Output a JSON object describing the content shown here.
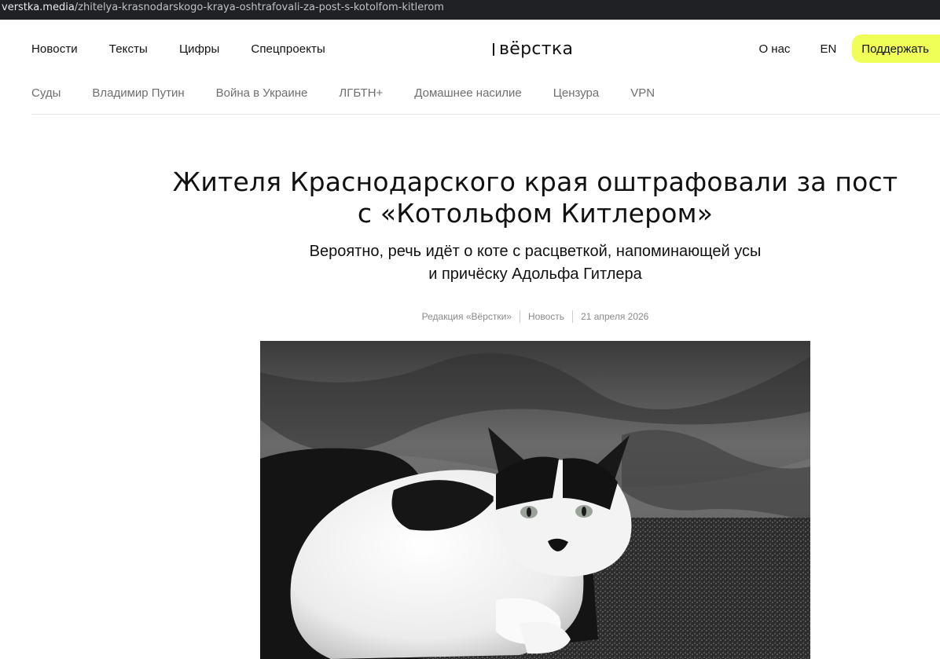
{
  "browser": {
    "url_host": "verstka.media",
    "url_path": "/zhitelya-krasnodarskogo-kraya-oshtrafovali-za-post-s-kotolfom-kitlerom"
  },
  "header": {
    "nav": [
      "Новости",
      "Тексты",
      "Цифры",
      "Спецпроекты"
    ],
    "logo": "вёрстка",
    "about": "О нас",
    "lang": "EN",
    "support": "Поддержать",
    "accent_color": "#f0ff57"
  },
  "tags": [
    "Суды",
    "Владимир Путин",
    "Война в Украине",
    "ЛГБТН+",
    "Домашнее насилие",
    "Цензура",
    "VPN"
  ],
  "article": {
    "title_line1": "Жителя Краснодарского края оштрафовали за пост",
    "title_line2": "с «Котольфом Китлером»",
    "subtitle_line1": "Вероятно, речь идёт о коте с расцветкой, напоминающей усы",
    "subtitle_line2": "и причёску Адольфа Гитлера",
    "author": "Редакция «Вёрстки»",
    "category": "Новость",
    "date": "21 апреля 2026",
    "image": "black-and-white-cat-photo"
  }
}
